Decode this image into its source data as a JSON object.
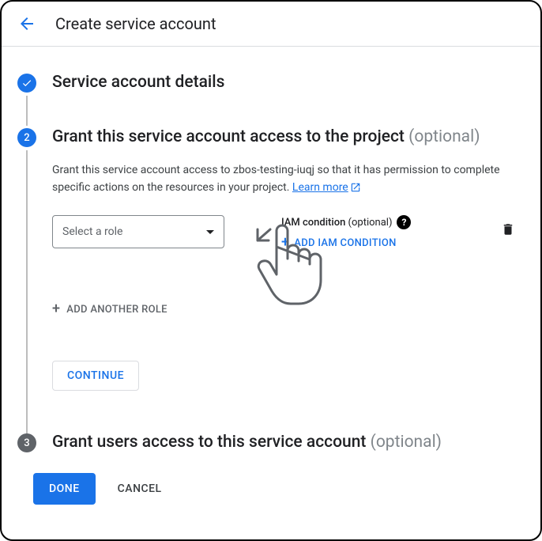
{
  "header": {
    "title": "Create service account"
  },
  "step1": {
    "title": "Service account details"
  },
  "step2": {
    "number": "2",
    "title": "Grant this service account access to the project",
    "optional": "(optional)",
    "description_prefix": "Grant this service account access to zbos-testing-iuqj so that it has permission to complete specific actions on the resources in your project. ",
    "learn_more": "Learn more",
    "role_placeholder": "Select a role",
    "iam_label": "IAM condition",
    "iam_optional": "(optional)",
    "add_iam": "ADD IAM CONDITION",
    "add_role": "ADD ANOTHER ROLE",
    "continue": "CONTINUE"
  },
  "step3": {
    "number": "3",
    "title": "Grant users access to this service account",
    "optional": "(optional)"
  },
  "footer": {
    "done": "DONE",
    "cancel": "CANCEL"
  }
}
